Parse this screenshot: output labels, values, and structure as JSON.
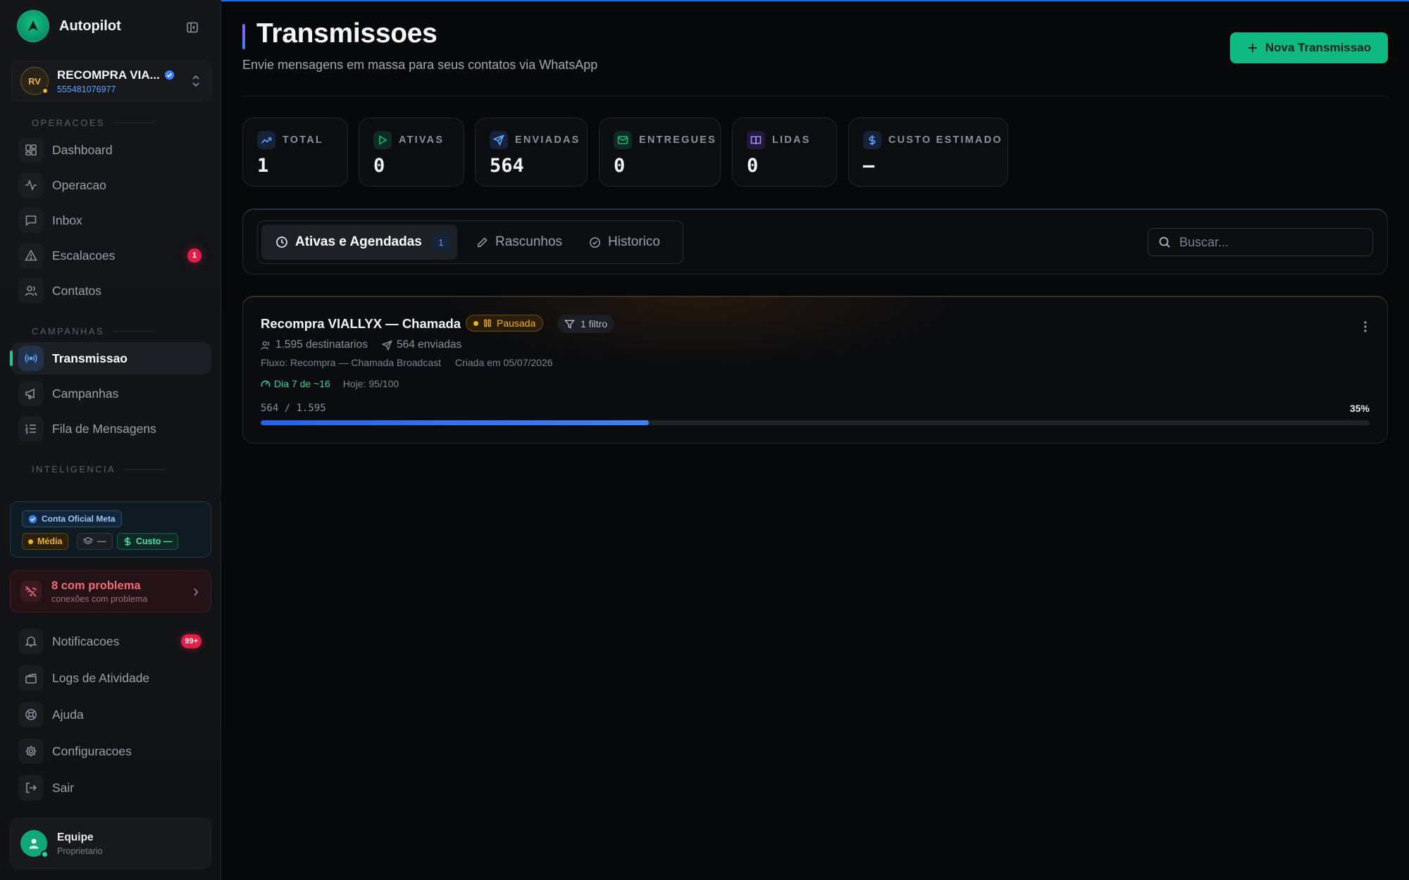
{
  "brand": {
    "name": "Autopilot"
  },
  "account": {
    "initials": "RV",
    "name": "RECOMPRA VIA...",
    "phone": "555481076977"
  },
  "sections": {
    "operacoes": "OPERACOES",
    "campanhas": "CAMPANHAS",
    "inteligencia": "INTELIGENCIA"
  },
  "nav": {
    "dashboard": "Dashboard",
    "operacao": "Operacao",
    "inbox": "Inbox",
    "escalacoes": "Escalacoes",
    "escalacoes_badge": "1",
    "contatos": "Contatos",
    "transmissao": "Transmissao",
    "campanhas": "Campanhas",
    "fila": "Fila de Mensagens",
    "notificacoes": "Notificacoes",
    "notificacoes_badge": "99+",
    "logs": "Logs de Atividade",
    "ajuda": "Ajuda",
    "configuracoes": "Configuracoes",
    "sair": "Sair"
  },
  "meta": {
    "official": "Conta Oficial Meta",
    "media": "Média",
    "layers": "—",
    "cost": "Custo —"
  },
  "problem": {
    "title": "8 com problema",
    "subtitle": "conexões com problema"
  },
  "user": {
    "name": "Equipe",
    "role": "Proprietario"
  },
  "header": {
    "title": "Transmissoes",
    "subtitle": "Envie mensagens em massa para seus contatos via WhatsApp",
    "new_button": "Nova Transmissao"
  },
  "stats": [
    {
      "label": "TOTAL",
      "value": "1",
      "icon": "trending-up-icon",
      "color": "#3b82f6"
    },
    {
      "label": "ATIVAS",
      "value": "0",
      "icon": "play-icon",
      "color": "#10b981"
    },
    {
      "label": "ENVIADAS",
      "value": "564",
      "icon": "send-icon",
      "color": "#3b82f6"
    },
    {
      "label": "ENTREGUES",
      "value": "0",
      "icon": "mail-check-icon",
      "color": "#10b981"
    },
    {
      "label": "LIDAS",
      "value": "0",
      "icon": "book-open-icon",
      "color": "#8b5cf6"
    },
    {
      "label": "CUSTO ESTIMADO",
      "value": "—",
      "icon": "dollar-icon",
      "color": "#3b82f6"
    }
  ],
  "tabs": {
    "active_label": "Ativas e Agendadas",
    "active_count": "1",
    "drafts_label": "Rascunhos",
    "history_label": "Historico"
  },
  "search": {
    "placeholder": "Buscar..."
  },
  "broadcast": {
    "title": "Recompra VIALLYX — Chamada",
    "status": "Pausada",
    "filter": "1 filtro",
    "recipients": "1.595 destinatarios",
    "sent": "564 enviadas",
    "flow": "Fluxo: Recompra — Chamada Broadcast",
    "created": "Criada em 05/07/2026",
    "day": "Dia 7 de ~16",
    "today": "Hoje: 95/100",
    "progress_text": "564 / 1.595",
    "progress_pct": "35%",
    "progress_fraction": 0.35
  }
}
